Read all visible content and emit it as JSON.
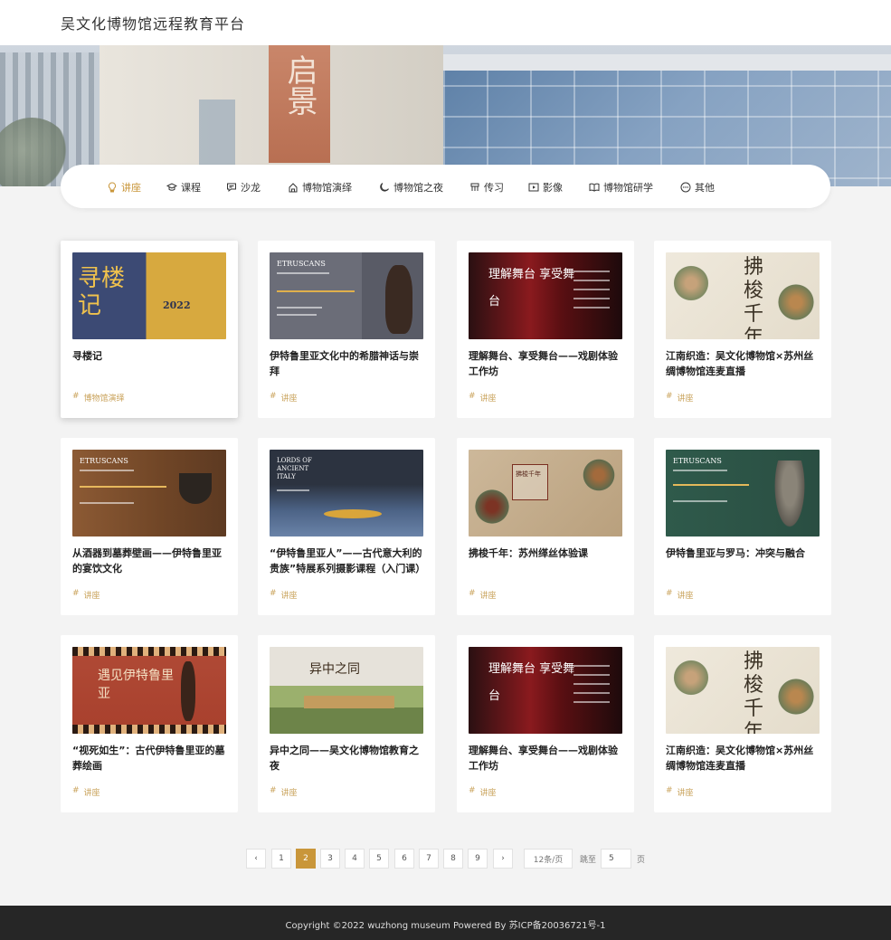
{
  "header": {
    "title": "吴文化博物馆远程教育平台"
  },
  "banner": {
    "poster_text": "启景"
  },
  "nav": {
    "items": [
      {
        "label": "讲座",
        "icon": "lamp-icon",
        "active": true
      },
      {
        "label": "课程",
        "icon": "graduation-cap-icon"
      },
      {
        "label": "沙龙",
        "icon": "chat-icon"
      },
      {
        "label": "博物馆演绎",
        "icon": "theater-icon"
      },
      {
        "label": "博物馆之夜",
        "icon": "moon-icon"
      },
      {
        "label": "传习",
        "icon": "craft-icon"
      },
      {
        "label": "影像",
        "icon": "play-icon"
      },
      {
        "label": "博物馆研学",
        "icon": "book-icon"
      },
      {
        "label": "其他",
        "icon": "more-icon"
      }
    ]
  },
  "cards": [
    {
      "title": "寻楼记",
      "tag": "博物馆演绎",
      "thumb_text": "寻楼记",
      "thumb_sub": "2022"
    },
    {
      "title": "伊特鲁里亚文化中的希腊神话与崇拜",
      "tag": "讲座",
      "thumb_text": "ETRUSCANS"
    },
    {
      "title": "理解舞台、享受舞台——戏剧体验工作坊",
      "tag": "讲座",
      "thumb_text": "理解舞台 享受舞台"
    },
    {
      "title": "江南织造：吴文化博物馆×苏州丝绸博物馆连麦直播",
      "tag": "讲座",
      "thumb_text": "拂梭千年"
    },
    {
      "title": "从酒器到墓葬壁画——伊特鲁里亚的宴饮文化",
      "tag": "讲座",
      "thumb_text": "ETRUSCANS"
    },
    {
      "title": "“伊特鲁里亚人”——古代意大利的贵族”特展系列摄影课程（入门课）",
      "tag": "讲座",
      "thumb_text": "LORDS OF ANCIENT ITALY"
    },
    {
      "title": "拂梭千年：苏州缂丝体验课",
      "tag": "讲座",
      "thumb_text": "拂梭千年"
    },
    {
      "title": "伊特鲁里亚与罗马：冲突与融合",
      "tag": "讲座",
      "thumb_text": "ETRUSCANS"
    },
    {
      "title": "“视死如生”：古代伊特鲁里亚的墓葬绘画",
      "tag": "讲座",
      "thumb_text": "遇见伊特鲁里亚"
    },
    {
      "title": "异中之同——吴文化博物馆教育之夜",
      "tag": "讲座",
      "thumb_text": "异中之同"
    },
    {
      "title": "理解舞台、享受舞台——戏剧体验工作坊",
      "tag": "讲座",
      "thumb_text": "理解舞台 享受舞台"
    },
    {
      "title": "江南织造：吴文化博物馆×苏州丝绸博物馆连麦直播",
      "tag": "讲座",
      "thumb_text": "拂梭千年"
    }
  ],
  "pagination": {
    "prev": "‹",
    "next": "›",
    "pages": [
      "1",
      "2",
      "3",
      "4",
      "5",
      "6",
      "7",
      "8",
      "9"
    ],
    "current": "2",
    "page_size": "12条/页",
    "jump_label": "跳至",
    "jump_value": "5",
    "page_unit": "页"
  },
  "footer": {
    "text": "Copyright ©2022 wuzhong museum Powered By 苏ICP备20036721号-1"
  },
  "colors": {
    "accent": "#c9963a",
    "tag": "#c9a25a",
    "footer_bg": "#262626"
  }
}
